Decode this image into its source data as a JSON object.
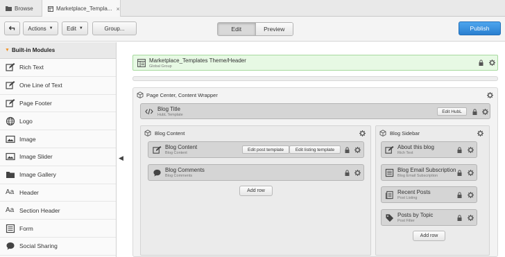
{
  "tabs": [
    {
      "label": "Browse",
      "icon": "folder-icon"
    },
    {
      "label": "Marketplace_Templa...",
      "icon": "template-icon",
      "close": "×"
    }
  ],
  "toolbar": {
    "back_icon": "back-arrow-icon",
    "actions_label": "Actions",
    "edit_label": "Edit",
    "group_label": "Group...",
    "mode_edit": "Edit",
    "mode_preview": "Preview",
    "publish_label": "Publish",
    "colors": {
      "publish": "#2a7fd0"
    }
  },
  "sidebar": {
    "heading": "Built-in Modules",
    "items": [
      {
        "label": "Rich Text",
        "icon": "edit-icon"
      },
      {
        "label": "One Line of Text",
        "icon": "edit-icon"
      },
      {
        "label": "Page Footer",
        "icon": "edit-icon"
      },
      {
        "label": "Logo",
        "icon": "globe-icon"
      },
      {
        "label": "Image",
        "icon": "image-icon"
      },
      {
        "label": "Image Slider",
        "icon": "image-icon"
      },
      {
        "label": "Image Gallery",
        "icon": "folder-icon"
      },
      {
        "label": "Header",
        "icon": "text-size-icon"
      },
      {
        "label": "Section Header",
        "icon": "text-size-icon"
      },
      {
        "label": "Form",
        "icon": "form-icon"
      },
      {
        "label": "Social Sharing",
        "icon": "chat-icon"
      }
    ]
  },
  "header_module": {
    "title": "Marketplace_Templates Theme/Header",
    "sub": "Global Group"
  },
  "wrapper": {
    "title": "Page Center, Content Wrapper",
    "blog_title": {
      "title": "Blog Title",
      "sub": "HubL Template",
      "button": "Edit HubL"
    },
    "blog_content": {
      "title": "Blog Content",
      "modules": [
        {
          "title": "Blog Content",
          "sub": "Blog Content",
          "btn1": "Edit post template",
          "btn2": "Edit listing template"
        },
        {
          "title": "Blog Comments",
          "sub": "Blog Comments"
        }
      ],
      "add_row": "Add row"
    },
    "blog_sidebar": {
      "title": "Blog Sidebar",
      "modules": [
        {
          "title": "About this blog",
          "sub": "Rich Text"
        },
        {
          "title": "Blog Email Subscription",
          "sub": "Blog Email Subscription"
        },
        {
          "title": "Recent Posts",
          "sub": "Post Listing"
        },
        {
          "title": "Posts by Topic",
          "sub": "Post Filter"
        }
      ],
      "add_row": "Add row"
    }
  }
}
